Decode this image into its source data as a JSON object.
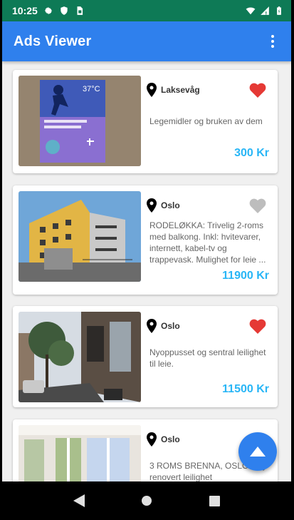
{
  "status_bar": {
    "time": "10:25",
    "background_color": "#0e7a56",
    "left_icons": [
      "gear-icon",
      "shield-icon",
      "sim-card-icon"
    ],
    "right_icons": [
      "wifi-icon",
      "cell-signal-icon",
      "battery-icon"
    ]
  },
  "app_bar": {
    "title": "Ads Viewer",
    "background_color": "#2f80ed",
    "menu_icon": "overflow-menu-icon"
  },
  "ads": [
    {
      "location": "Laksevåg",
      "description": "Legemidler og bruken av dem",
      "price": "300 Kr",
      "favorite": true,
      "image": "book-cover-photo"
    },
    {
      "location": "Oslo",
      "description": "RODELØKKA: Trivelig 2-roms med balkong. Inkl: hvitevarer, internett, kabel-tv og trappevask. Mulighet for leie ...",
      "price": "11900 Kr",
      "favorite": false,
      "image": "apartment-building-photo"
    },
    {
      "location": "Oslo",
      "description": "Nyoppusset og sentral leilighet til leie.",
      "price": "11500 Kr",
      "favorite": true,
      "image": "street-view-photo"
    },
    {
      "location": "Oslo",
      "description": "3 ROMS BRENNA, OSLO - Ny renovert leilighet",
      "price": "",
      "favorite": false,
      "image": "bright-room-photo"
    }
  ],
  "colors": {
    "price": "#29b6f6",
    "heart_active": "#e53935",
    "heart_inactive": "#bdbdbd"
  },
  "fab": {
    "icon": "arrow-up-icon"
  },
  "nav_bar": {
    "icons": [
      "back-icon",
      "home-icon",
      "recents-icon"
    ]
  }
}
